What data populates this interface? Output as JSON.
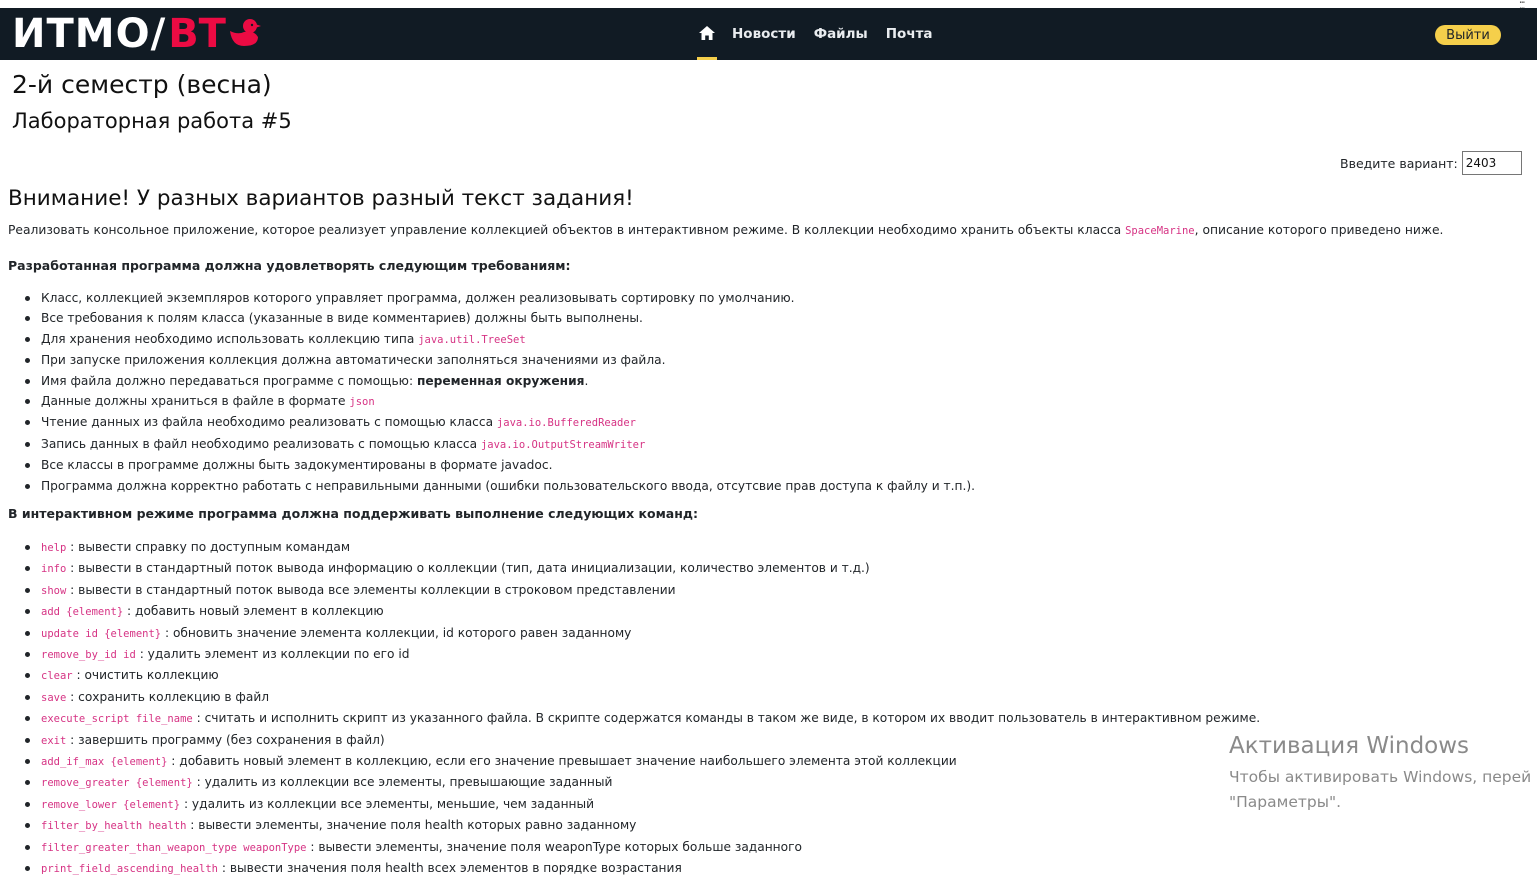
{
  "window": {
    "corner_icon": "grid-dots-icon"
  },
  "navbar": {
    "logo_left": "ИТМО/",
    "logo_right": "ВТ",
    "logo_icon": "duck-icon",
    "home_icon": "home-icon",
    "links": [
      "Новости",
      "Файлы",
      "Почта"
    ],
    "logout_label": "Выйти",
    "colors": {
      "background": "#111b24",
      "accent": "#f5cf4b",
      "logo_red": "#ec0b43"
    }
  },
  "header": {
    "semester": "2-й семестр (весна)",
    "lab": "Лабораторная работа #5"
  },
  "variant": {
    "label": "Введите вариант:",
    "value": "2403"
  },
  "warning": "Внимание! У разных вариантов разный текст задания!",
  "intro": {
    "before": "Реализовать консольное приложение, которое реализует управление коллекцией объектов в интерактивном режиме. В коллекции необходимо хранить объекты класса ",
    "code": "SpaceMarine",
    "after": ", описание которого приведено ниже."
  },
  "requirements": {
    "heading": "Разработанная программа должна удовлетворять следующим требованиям:",
    "items": [
      {
        "text": "Класс, коллекцией экземпляров которого управляет программа, должен реализовывать сортировку по умолчанию.",
        "code": "",
        "bold": "",
        "after": ""
      },
      {
        "text": "Все требования к полям класса (указанные в виде комментариев) должны быть выполнены.",
        "code": "",
        "bold": "",
        "after": ""
      },
      {
        "text": "Для хранения необходимо использовать коллекцию типа ",
        "code": "java.util.TreeSet",
        "bold": "",
        "after": ""
      },
      {
        "text": "При запуске приложения коллекция должна автоматически заполняться значениями из файла.",
        "code": "",
        "bold": "",
        "after": ""
      },
      {
        "text": "Имя файла должно передаваться программе с помощью: ",
        "code": "",
        "bold": "переменная окружения",
        "after": "."
      },
      {
        "text": "Данные должны храниться в файле в формате ",
        "code": "json",
        "bold": "",
        "after": ""
      },
      {
        "text": "Чтение данных из файла необходимо реализовать с помощью класса ",
        "code": "java.io.BufferedReader",
        "bold": "",
        "after": ""
      },
      {
        "text": "Запись данных в файл необходимо реализовать с помощью класса ",
        "code": "java.io.OutputStreamWriter",
        "bold": "",
        "after": ""
      },
      {
        "text": "Все классы в программе должны быть задокументированы в формате javadoc.",
        "code": "",
        "bold": "",
        "after": ""
      },
      {
        "text": "Программа должна корректно работать с неправильными данными (ошибки пользовательского ввода, отсутсвие прав доступа к файлу и т.п.).",
        "code": "",
        "bold": "",
        "after": ""
      }
    ]
  },
  "commands": {
    "heading": "В интерактивном режиме программа должна поддерживать выполнение следующих команд:",
    "items": [
      {
        "code": "help",
        "text": " : вывести справку по доступным командам"
      },
      {
        "code": "info",
        "text": " : вывести в стандартный поток вывода информацию о коллекции (тип, дата инициализации, количество элементов и т.д.)"
      },
      {
        "code": "show",
        "text": " : вывести в стандартный поток вывода все элементы коллекции в строковом представлении"
      },
      {
        "code": "add {element}",
        "text": " : добавить новый элемент в коллекцию"
      },
      {
        "code": "update id {element}",
        "text": " : обновить значение элемента коллекции, id которого равен заданному"
      },
      {
        "code": "remove_by_id id",
        "text": " : удалить элемент из коллекции по его id"
      },
      {
        "code": "clear",
        "text": " : очистить коллекцию"
      },
      {
        "code": "save",
        "text": " : сохранить коллекцию в файл"
      },
      {
        "code": "execute_script file_name",
        "text": " : считать и исполнить скрипт из указанного файла. В скрипте содержатся команды в таком же виде, в котором их вводит пользователь в интерактивном режиме."
      },
      {
        "code": "exit",
        "text": " : завершить программу (без сохранения в файл)"
      },
      {
        "code": "add_if_max {element}",
        "text": " : добавить новый элемент в коллекцию, если его значение превышает значение наибольшего элемента этой коллекции"
      },
      {
        "code": "remove_greater {element}",
        "text": " : удалить из коллекции все элементы, превышающие заданный"
      },
      {
        "code": "remove_lower {element}",
        "text": " : удалить из коллекции все элементы, меньшие, чем заданный"
      },
      {
        "code": "filter_by_health health",
        "text": " : вывести элементы, значение поля health которых равно заданному"
      },
      {
        "code": "filter_greater_than_weapon_type weaponType",
        "text": " : вывести элементы, значение поля weaponType которых больше заданного"
      },
      {
        "code": "print_field_ascending_health",
        "text": " : вывести значения поля health всех элементов в порядке возрастания"
      }
    ]
  },
  "activation": {
    "title": "Активация Windows",
    "line1": "Чтобы активировать Windows, перей",
    "line2": "\"Параметры\"."
  }
}
